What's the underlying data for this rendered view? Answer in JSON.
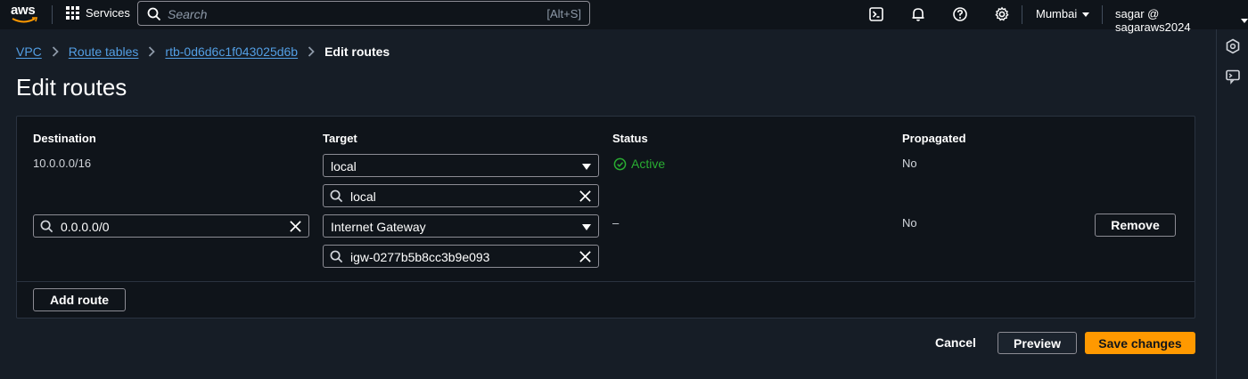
{
  "nav": {
    "logo": "aws",
    "services_label": "Services",
    "search_placeholder": "Search",
    "search_shortcut": "[Alt+S]",
    "region": "Mumbai",
    "user": "sagar @ sagaraws2024",
    "icons": [
      "cloudshell-icon",
      "bell-icon",
      "help-icon",
      "gear-icon"
    ]
  },
  "breadcrumb": {
    "items": [
      "VPC",
      "Route tables",
      "rtb-0d6d6c1f043025d6b"
    ],
    "current": "Edit routes"
  },
  "page_title": "Edit routes",
  "table": {
    "headers": {
      "destination": "Destination",
      "target": "Target",
      "status": "Status",
      "propagated": "Propagated"
    },
    "rows": [
      {
        "destination": "10.0.0.0/16",
        "target_type": "local",
        "target_search": "local",
        "status": "Active",
        "propagated": "No"
      },
      {
        "destination": "0.0.0.0/0",
        "target_type": "Internet Gateway",
        "target_search": "igw-0277b5b8cc3b9e093",
        "status": "–",
        "propagated": "No",
        "remove_label": "Remove"
      }
    ],
    "add_route_label": "Add route"
  },
  "actions": {
    "cancel": "Cancel",
    "preview": "Preview",
    "save": "Save changes"
  },
  "colors": {
    "accent": "#ff9900",
    "link": "#539fe5",
    "success": "#29ad32"
  }
}
